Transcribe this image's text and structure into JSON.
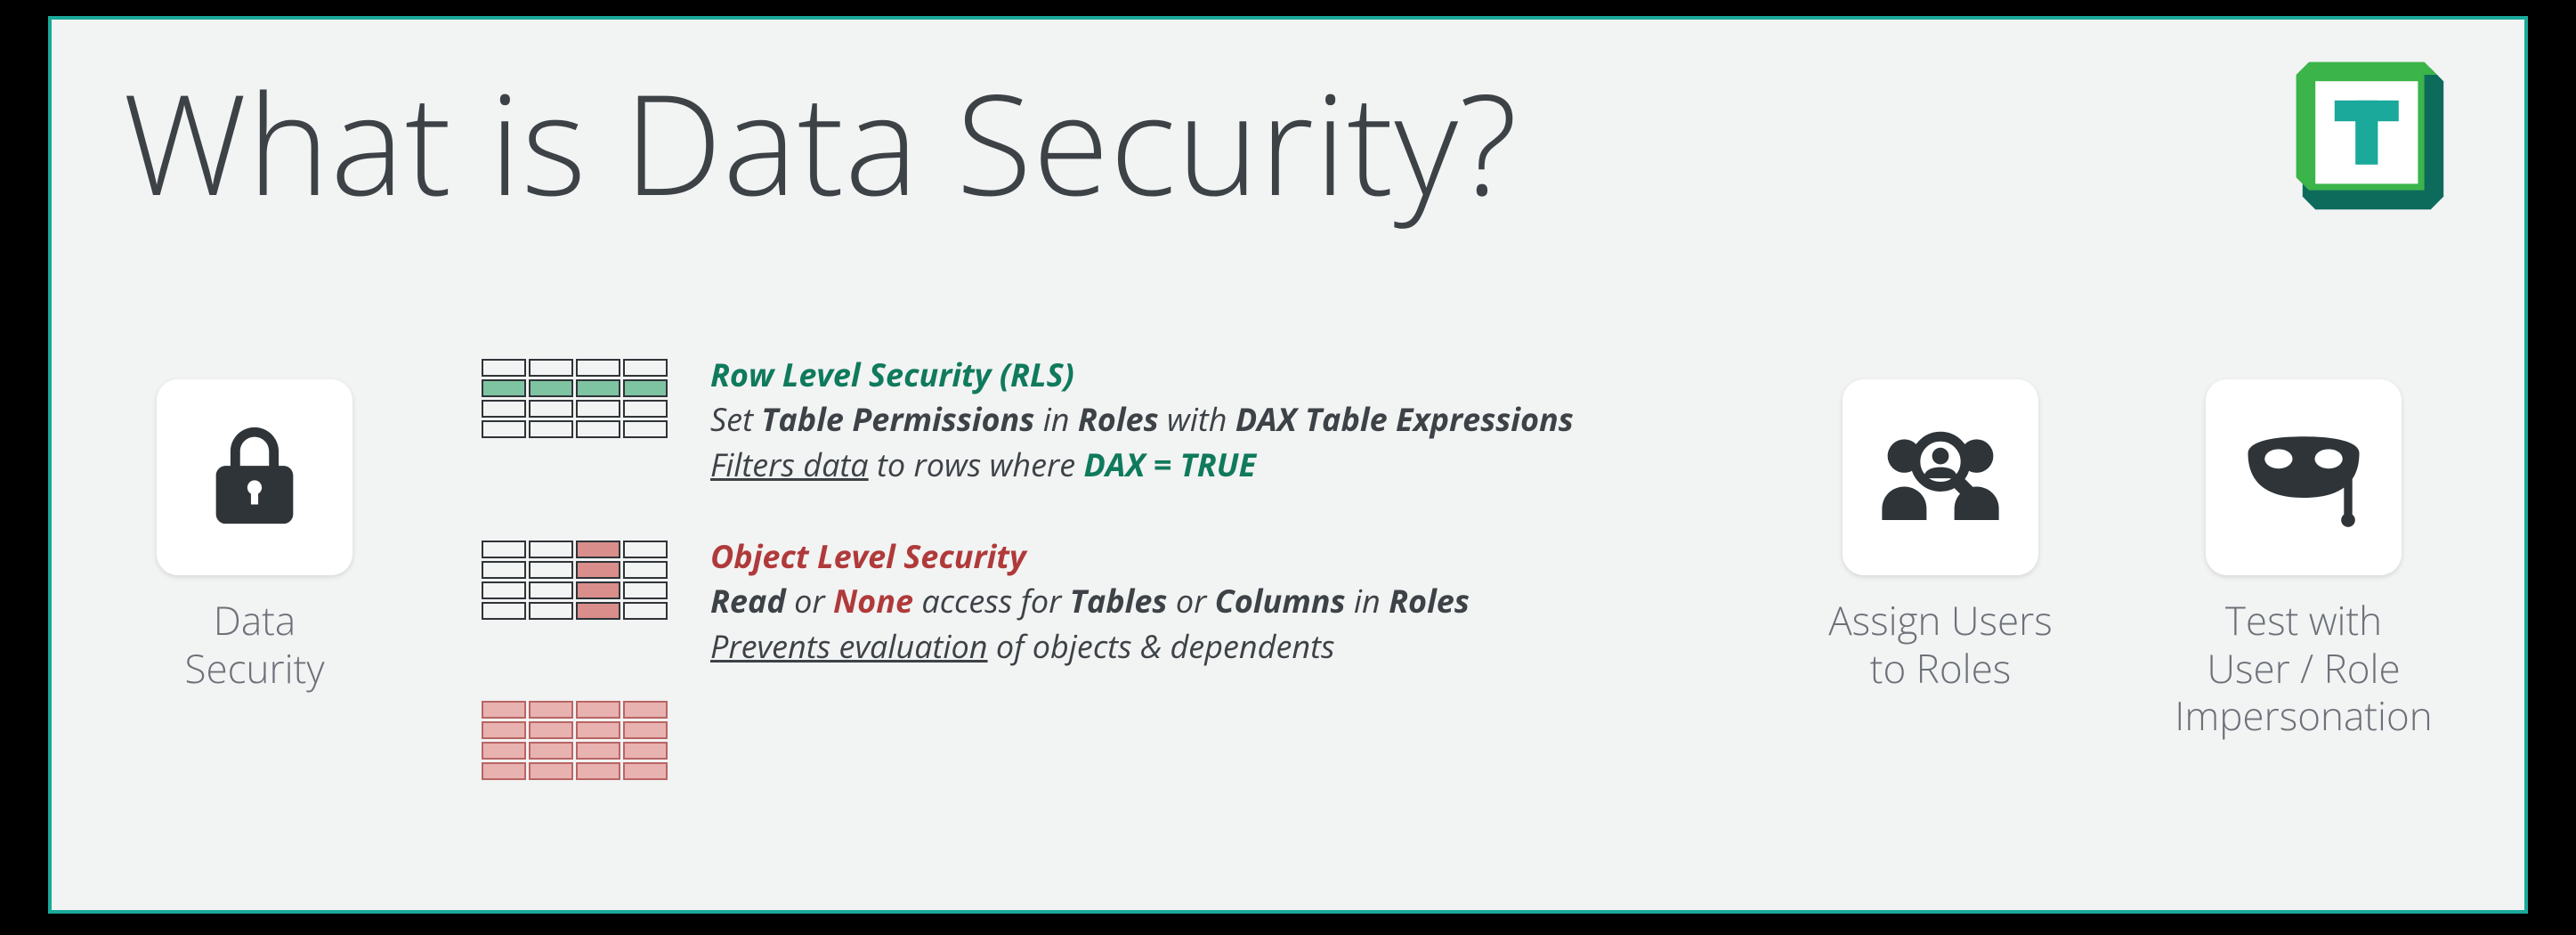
{
  "title": "What is Data Security?",
  "cards": {
    "data_security": "Data\nSecurity",
    "assign_users": "Assign Users\nto Roles",
    "test_impersonation": "Test with\nUser / Role\nImpersonation"
  },
  "rls": {
    "heading": "Row Level Security (RLS)",
    "line2_pre": "Set ",
    "line2_b1": "Table Permissions",
    "line2_mid": " in ",
    "line2_b2": "Roles",
    "line2_mid2": " with ",
    "line2_b3": "DAX Table Expressions",
    "line3_u": "Filters data",
    "line3_mid": " to rows where ",
    "line3_green": "DAX = TRUE"
  },
  "ols": {
    "heading": "Object Level Security",
    "line2_b1": "Read",
    "line2_mid1": " or ",
    "line2_red": "None",
    "line2_mid2": " access for ",
    "line2_b2": "Tables",
    "line2_mid3": " or ",
    "line2_b3": "Columns",
    "line2_mid4": " in ",
    "line2_b4": "Roles",
    "line3_u": "Prevents evaluation",
    "line3_rest": " of objects & dependents"
  },
  "colors": {
    "teal": "#1aa99a",
    "green_text": "#0f7a5c",
    "red_text": "#b03a3a"
  }
}
